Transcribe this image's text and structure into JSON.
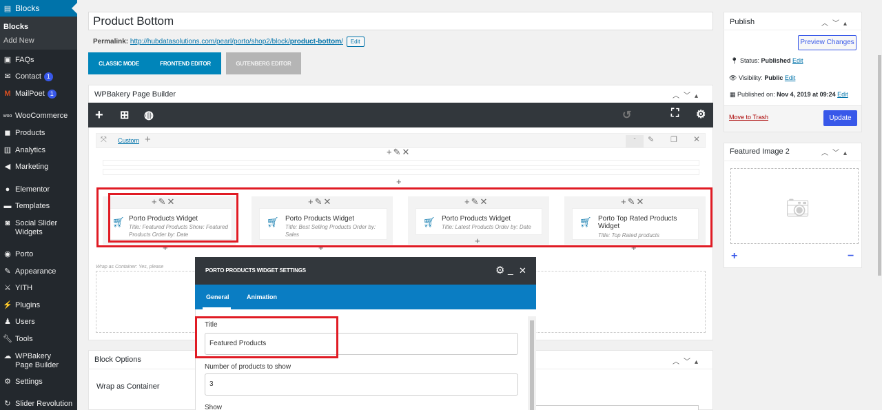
{
  "sidebar": {
    "active": "Blocks",
    "sub_items": [
      "Blocks",
      "Add New"
    ],
    "items": [
      {
        "label": "FAQs",
        "icon": "faq-icon"
      },
      {
        "label": "Contact",
        "icon": "mail-icon",
        "badge": "1"
      },
      {
        "label": "MailPoet",
        "icon": "mailpoet-icon",
        "badge": "1"
      },
      {
        "label": "WooCommerce",
        "icon": "woocommerce-icon"
      },
      {
        "label": "Products",
        "icon": "products-icon"
      },
      {
        "label": "Analytics",
        "icon": "analytics-icon"
      },
      {
        "label": "Marketing",
        "icon": "megaphone-icon"
      },
      {
        "label": "Elementor",
        "icon": "elementor-icon"
      },
      {
        "label": "Templates",
        "icon": "folder-icon"
      },
      {
        "label": "Social Slider Widgets",
        "icon": "instagram-icon"
      },
      {
        "label": "Porto",
        "icon": "porto-icon"
      },
      {
        "label": "Appearance",
        "icon": "brush-icon"
      },
      {
        "label": "YITH",
        "icon": "yith-icon"
      },
      {
        "label": "Plugins",
        "icon": "plugin-icon"
      },
      {
        "label": "Users",
        "icon": "users-icon"
      },
      {
        "label": "Tools",
        "icon": "wrench-icon"
      },
      {
        "label": "WPBakery Page Builder",
        "icon": "wpbakery-icon"
      },
      {
        "label": "Settings",
        "icon": "settings-icon"
      },
      {
        "label": "Slider Revolution",
        "icon": "revslider-icon"
      }
    ]
  },
  "post": {
    "title": "Product Bottom",
    "permalink_label": "Permalink:",
    "permalink_url": "http://hubdatasolutions.com/pearl/porto/shop2/block/",
    "permalink_slug": "product-bottom",
    "permalink_slash": "/",
    "edit_label": "Edit"
  },
  "modes": {
    "classic": "CLASSIC MODE",
    "frontend": "FRONTEND EDITOR",
    "gutenberg": "GUTENBERG EDITOR"
  },
  "wpbakery": {
    "title": "WPBakery Page Builder",
    "custom_label": "Custom",
    "wrap_note": "Wrap as Container: Yes, please",
    "widgets": [
      {
        "title": "Porto Products Widget",
        "desc": "Title: Featured Products  Show: Featured Products  Order by: Date"
      },
      {
        "title": "Porto Products Widget",
        "desc": "Title: Best Selling Products  Order by: Sales"
      },
      {
        "title": "Porto Products Widget",
        "desc": "Title: Latest Products  Order by: Date"
      },
      {
        "title": "Porto Top Rated Products Widget",
        "desc": "Title: Top Rated products"
      }
    ]
  },
  "modal": {
    "title": "PORTO PRODUCTS WIDGET SETTINGS",
    "tabs": [
      "General",
      "Animation"
    ],
    "title_label": "Title",
    "title_value": "Featured Products",
    "count_label": "Number of products to show",
    "count_value": "3",
    "show_label": "Show"
  },
  "block_options": {
    "title": "Block Options",
    "wrap_label": "Wrap as Container"
  },
  "publish": {
    "title": "Publish",
    "preview_label": "Preview Changes",
    "status_label": "Status:",
    "status_value": "Published",
    "visibility_label": "Visibility:",
    "visibility_value": "Public",
    "published_label": "Published on:",
    "published_value": "Nov 4, 2019 at 09:24",
    "edit": "Edit",
    "trash_label": "Move to Trash",
    "update_label": "Update"
  },
  "featured_image": {
    "title": "Featured Image 2",
    "add": "+",
    "remove": "−"
  },
  "colors": {
    "accent": "#0073aa",
    "highlight": "#e01b24",
    "modal_tabs": "#0a7dc3",
    "update_button": "#3858e9"
  }
}
